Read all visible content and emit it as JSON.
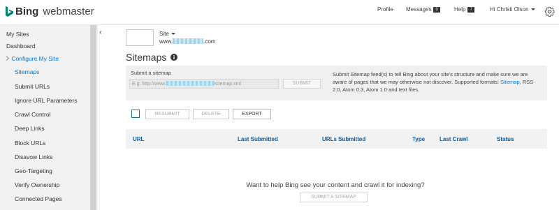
{
  "header": {
    "brand": "Bing",
    "product": "webmaster",
    "nav": {
      "profile": "Profile",
      "messages": "Messages",
      "messages_count": "0",
      "help": "Help",
      "help_count": "7",
      "user": "Hi Christi Olson"
    }
  },
  "sidebar": {
    "items": [
      {
        "label": "My Sites"
      },
      {
        "label": "Dashboard"
      },
      {
        "label": "Configure My Site"
      },
      {
        "label": "Sitemaps"
      },
      {
        "label": "Submit URLs"
      },
      {
        "label": "Ignore URL Parameters"
      },
      {
        "label": "Crawl Control"
      },
      {
        "label": "Deep Links"
      },
      {
        "label": "Block URLs"
      },
      {
        "label": "Disavow Links"
      },
      {
        "label": "Geo-Targeting"
      },
      {
        "label": "Verify Ownership"
      },
      {
        "label": "Connected Pages"
      }
    ],
    "collapse_glyph": "‹"
  },
  "site": {
    "label": "Site",
    "url_prefix": "www.",
    "url_suffix": ".com"
  },
  "page": {
    "title": "Sitemaps"
  },
  "submit_panel": {
    "label": "Submit a sitemap",
    "placeholder_prefix": "E.g. http://www.",
    "placeholder_suffix": "/sitemap.xml",
    "submit_label": "SUBMIT",
    "help_before": "Submit Sitemap feed(s) to tell Bing about your site's structure and make sure we are aware of pages that we may otherwise not discover. Supported formats: ",
    "help_link": "Sitemap",
    "help_after": ", RSS 2.0, Atom 0.3, Atom 1.0 and text files."
  },
  "toolbar": {
    "resubmit": "RESUBMIT",
    "delete": "DELETE",
    "export": "EXPORT"
  },
  "table": {
    "columns": [
      "URL",
      "Last Submitted",
      "URLs Submitted",
      "Type",
      "Last Crawl",
      "Status"
    ]
  },
  "empty_state": {
    "message": "Want to help Bing see your content and crawl it for indexing?",
    "button": "SUBMIT A SITEMAP"
  },
  "colors": {
    "accent": "#0078d7",
    "column_header": "#0a5aa0",
    "checkbox_border": "#0a7a8c",
    "bing_logo": "#008373"
  }
}
